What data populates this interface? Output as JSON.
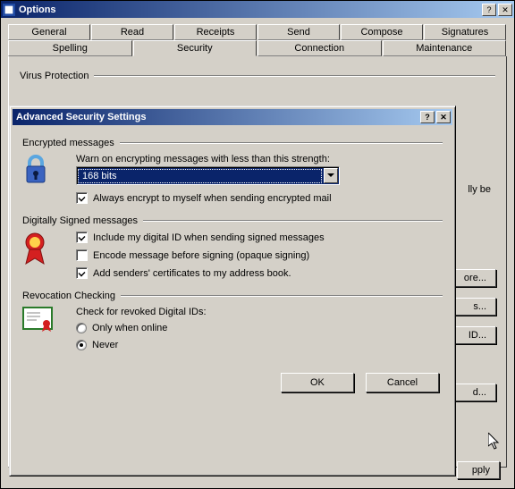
{
  "main": {
    "title": "Options",
    "tabs_row1": [
      "General",
      "Read",
      "Receipts",
      "Send",
      "Compose",
      "Signatures"
    ],
    "tabs_row2": [
      "Spelling",
      "Security",
      "Connection",
      "Maintenance"
    ],
    "active_tab": "Security",
    "virus_protection_label": "Virus Protection",
    "bg_frag": "lly be",
    "side_buttons": [
      "ore...",
      "s...",
      "ID...",
      "d..."
    ],
    "apply": "pply"
  },
  "adv": {
    "title": "Advanced Security Settings",
    "encrypted": {
      "label": "Encrypted messages",
      "warn": "Warn on encrypting messages with less than this strength:",
      "dropdown_value": "168 bits",
      "always_encrypt_self": "Always encrypt to myself when sending encrypted mail",
      "always_encrypt_self_checked": true
    },
    "signed": {
      "label": "Digitally Signed messages",
      "include_id": "Include my digital ID when sending signed messages",
      "include_id_checked": true,
      "encode_opaque": "Encode message before signing (opaque signing)",
      "encode_opaque_checked": false,
      "add_cert": "Add senders' certificates to my address book.",
      "add_cert_checked": true
    },
    "revocation": {
      "label": "Revocation Checking",
      "check": "Check for revoked Digital IDs:",
      "only_online": "Only when online",
      "never": "Never",
      "selected": "never"
    },
    "ok": "OK",
    "cancel": "Cancel"
  }
}
